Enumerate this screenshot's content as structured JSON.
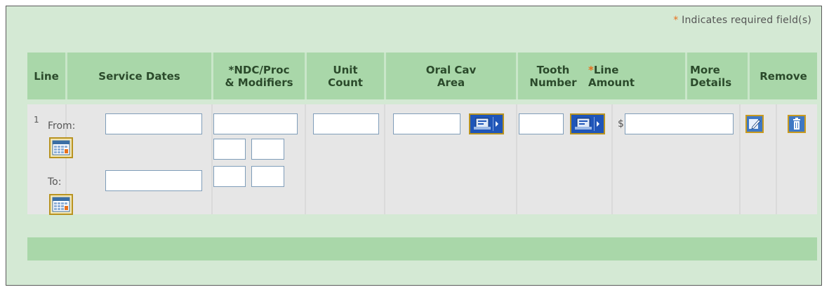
{
  "required_note": {
    "star": "*",
    "text": " Indicates required field(s)"
  },
  "columns": {
    "line": "Line",
    "service_dates": "Service Dates",
    "ndc_proc_1": "*NDC/Proc",
    "ndc_proc_2": "& Modifiers",
    "unit_count_1": "Unit",
    "unit_count_2": "Count",
    "oral_cav_1": "Oral Cav",
    "oral_cav_2": "Area",
    "tooth_1": "Tooth",
    "tooth_2": "Number",
    "line_amount_star": "*",
    "line_amount_1": "Line",
    "line_amount_2": "Amount",
    "more_details_1": "More",
    "more_details_2": "Details",
    "remove": "Remove"
  },
  "row": {
    "line_number": "1",
    "from_label": "From:",
    "to_label": "To:",
    "from_date": "",
    "to_date": "",
    "ndc_proc": "",
    "modifiers": [
      "",
      "",
      "",
      ""
    ],
    "unit_count": "",
    "oral_cav_area": "",
    "tooth_number": "",
    "currency_symbol": "$",
    "line_amount": ""
  },
  "colors": {
    "panel_background": "#d4e9d4",
    "header_background": "#a9d7a9",
    "row_background": "#e6e6e6",
    "required_star": "#e8701c"
  },
  "icons": {
    "calendar": "calendar-icon",
    "lookup": "lookup-picker-icon",
    "edit": "edit-details-icon",
    "remove": "trash-icon"
  }
}
